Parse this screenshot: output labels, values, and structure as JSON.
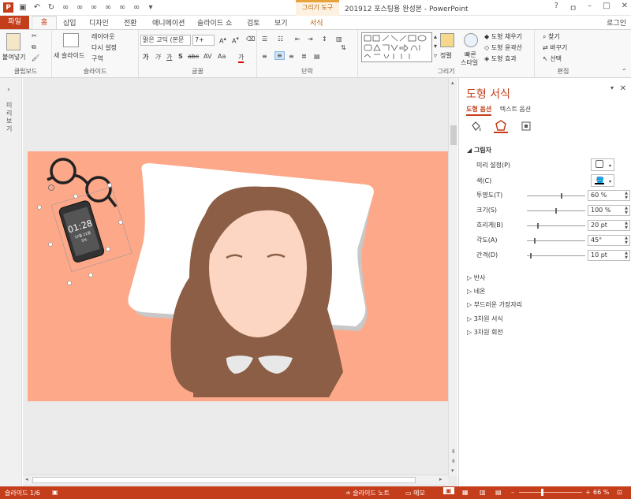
{
  "app": {
    "title": "201912 포스팅용 완성본 - PowerPoint",
    "context_header": "그리기 도구",
    "login": "로그인",
    "window_controls": [
      "?",
      "ㅁ",
      "–",
      "□",
      "✕"
    ]
  },
  "tabs": [
    "파일",
    "홈",
    "삽입",
    "디자인",
    "전환",
    "애니메이션",
    "슬라이드 쇼",
    "검토",
    "보기",
    "서식"
  ],
  "ribbon": {
    "groups": [
      "클립보드",
      "슬라이드",
      "글꼴",
      "단락",
      "그리기",
      "편집"
    ],
    "paste": "붙여넣기",
    "new_slide": "새 슬라이드",
    "layout": "레이아웃",
    "reset": "다시 설정",
    "section": "구역",
    "font_name": "맑은 고딕 (본문",
    "font_size": "7+",
    "arrange": "정렬",
    "quick_styles_l1": "빠른",
    "quick_styles_l2": "스타일",
    "shape_fill": "도형 채우기",
    "shape_outline": "도형 윤곽선",
    "shape_effects": "도형 효과",
    "find": "찾기",
    "replace": "바꾸기",
    "select": "선택",
    "font_row2": [
      "가",
      "가",
      "가",
      "S",
      "abc",
      "AV",
      "Aa",
      "가"
    ]
  },
  "thumbnails_label": "미리 보기",
  "phone": {
    "time": "01:28",
    "line2": "12월 21일",
    "line3": "5%"
  },
  "panel": {
    "title": "도형 서식",
    "tabs": [
      "도형 옵션",
      "텍스트 옵션"
    ],
    "section_shadow": "그림자",
    "preset": "미리 설정(P)",
    "color": "색(C)",
    "props": [
      {
        "label": "투명도(T)",
        "value": "60 %",
        "level": 0.6
      },
      {
        "label": "크기(S)",
        "value": "100 %",
        "level": 0.5
      },
      {
        "label": "흐리게(B)",
        "value": "20 pt",
        "level": 0.18
      },
      {
        "label": "각도(A)",
        "value": "45°",
        "level": 0.12
      },
      {
        "label": "간격(D)",
        "value": "10 pt",
        "level": 0.05
      }
    ],
    "collapsed": [
      "반사",
      "네온",
      "부드러운 가장자리",
      "3차원 서식",
      "3차원 회전"
    ]
  },
  "status": {
    "slide": "슬라이드 1/6",
    "notes": "슬라이드 노트",
    "comments": "메모",
    "zoom": "66 %"
  },
  "colors": {
    "accent": "#c43e1c",
    "slide_bg": "#fda889",
    "hair": "#8b5e45",
    "skin": "#fcd6c3",
    "pillow": "#ffffff"
  }
}
